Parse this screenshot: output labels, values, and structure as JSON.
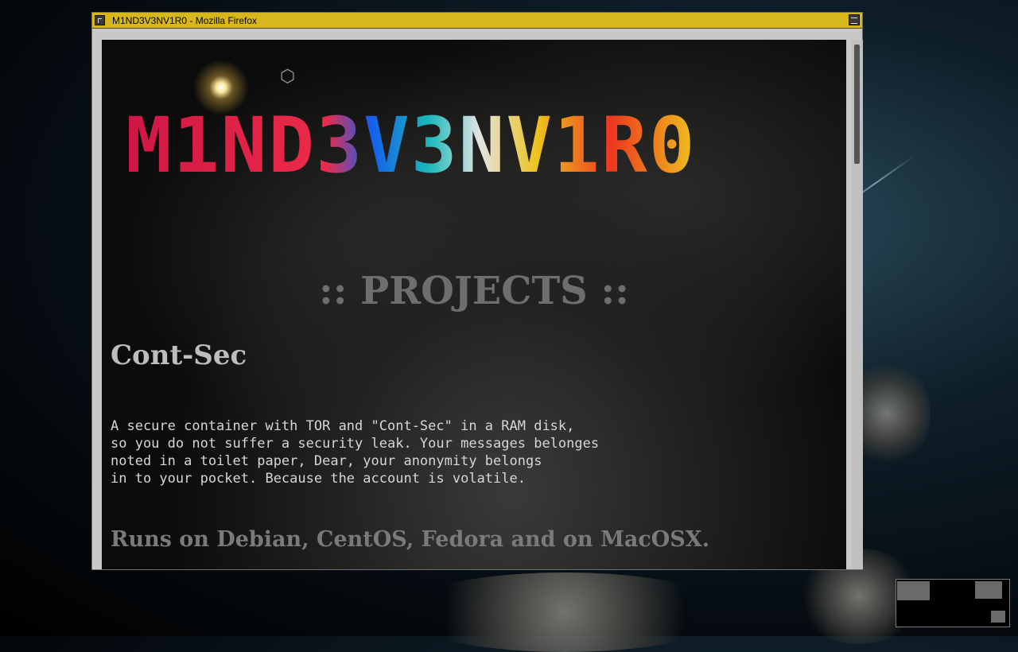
{
  "window": {
    "title": "M1ND3V3NV1R0 - Mozilla Firefox",
    "titlebar_color": "#d6b81e"
  },
  "page": {
    "logo_text": "M1ND3V3NV1R0",
    "section_heading": ":: PROJECTS ::",
    "project": {
      "title": "Cont-Sec",
      "description_lines": [
        "A secure container with TOR and \"Cont-Sec\" in a RAM disk,",
        "so you do not suffer a security leak. Your messages belonges",
        "noted in a toilet paper, Dear, your anonymity belongs",
        "in to your pocket. Because the account is volatile."
      ],
      "platforms": "Runs on Debian, CentOS, Fedora and on MacOSX."
    }
  },
  "icons": [
    "window-menu-icon",
    "maximize-icon",
    "hexagon-icon"
  ]
}
